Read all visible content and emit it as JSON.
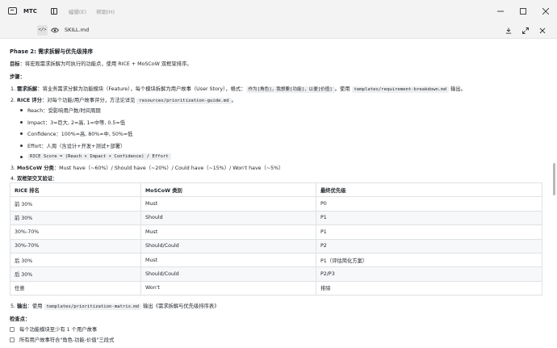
{
  "titlebar": {
    "app_name": "MTC",
    "menu": [
      "编辑(E)",
      "帮助(H)"
    ]
  },
  "tab": {
    "code_label": "</>",
    "file_name": "SKILL.md"
  },
  "doc": {
    "heading": "Phase 2: 需求拆解与优先级排序",
    "goal_label": "目标",
    "goal_text": "：将宏观需求拆解为可执行的功能点，使用 RICE + MoSCoW 双框架排序。",
    "steps_label": "步骤：",
    "step1": {
      "num": "1.",
      "label": "需求拆解",
      "text_a": "：将业务需求分解为功能模块（Feature），每个模块拆解为用户故事（User Story），格式：",
      "code_a": "作为[角色]，我想要[功能]，以便[价值]",
      "text_b": "。使用",
      "code_b": "templates/requirement-breakdown.md",
      "text_c": "输出。"
    },
    "step2": {
      "num": "2.",
      "label": "RICE 评分",
      "text_a": "：对每个功能/用户故事评分，方法论详见",
      "code_a": "resources/prioritization-guide.md",
      "text_b": "。"
    },
    "rice_items": [
      "Reach：受影响用户数/时间周期",
      "Impact：3=巨大, 2=高, 1=中等, 0.5=低",
      "Confidence：100%=高, 80%=中, 50%=低",
      "Effort：人周（含设计+开发+测试+部署）"
    ],
    "rice_formula": "RICE Score = (Reach × Impact × Confidence) / Effort",
    "step3": {
      "num": "3.",
      "label": "MoSCoW 分类",
      "text": "：Must have（~60%）/ Should have（~20%）/ Could have（~15%）/ Won't have（~5%）"
    },
    "step4": {
      "num": "4.",
      "label": "双框架交叉验证",
      "text": "："
    },
    "step5": {
      "num": "5.",
      "label": "输出",
      "text_a": "：使用",
      "code": "templates/prioritization-matrix.md",
      "text_b": "输出《需求拆解与优先级排序表》"
    },
    "checkpoints_label": "检查点：",
    "checkpoints": [
      "每个功能模块至少有 1 个用户故事",
      "所有用户故事符合\"角色-功能-价值\"三段式"
    ]
  },
  "table": {
    "headers": [
      "RICE 排名",
      "MoSCoW 类别",
      "最终优先级"
    ],
    "rows": [
      [
        "前 30%",
        "Must",
        "P0"
      ],
      [
        "前 30%",
        "Should",
        "P1"
      ],
      [
        "30%-70%",
        "Must",
        "P1"
      ],
      [
        "30%-70%",
        "Should/Could",
        "P2"
      ],
      [
        "后 30%",
        "Must",
        "P1（评估简化方案）"
      ],
      [
        "后 30%",
        "Should/Could",
        "P2/P3"
      ],
      [
        "任意",
        "Won't",
        "排除"
      ]
    ]
  }
}
